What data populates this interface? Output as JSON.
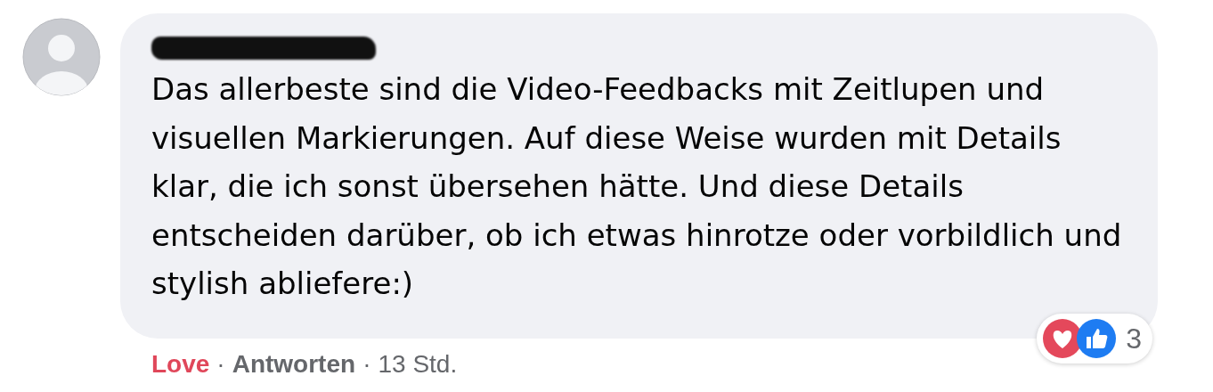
{
  "comment": {
    "author": {
      "redacted": true
    },
    "text": "Das allerbeste sind die Video-Feedbacks mit Zeitlupen und visuellen Markierungen. Auf diese Weise wurden mit Details klar, die ich sonst übersehen hätte. Und diese Details entscheiden darüber, ob ich etwas hinrotze oder vorbildlich und stylish abliefere:)",
    "reactions": {
      "icons": [
        {
          "kind": "love"
        },
        {
          "kind": "like"
        }
      ],
      "count": "3"
    },
    "actions": [
      {
        "kind": "reaction",
        "label": "Love",
        "selected": true
      },
      {
        "kind": "separator",
        "label": "·"
      },
      {
        "kind": "reply",
        "label": "Antworten"
      },
      {
        "kind": "separator",
        "label": "·"
      },
      {
        "kind": "time",
        "label": "13 Std."
      }
    ]
  }
}
